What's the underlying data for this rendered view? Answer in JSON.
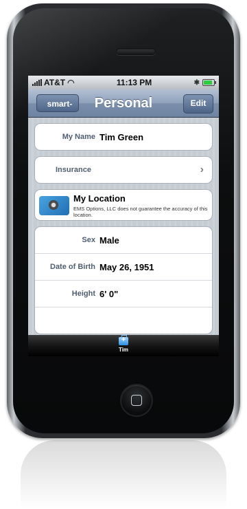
{
  "status_bar": {
    "carrier": "AT&T",
    "time": "11:13 PM"
  },
  "nav": {
    "back_label": "smart-ICE",
    "title": "Personal",
    "edit_label": "Edit"
  },
  "name_row": {
    "label": "My Name",
    "value": "Tim Green"
  },
  "insurance_row": {
    "label": "Insurance"
  },
  "location": {
    "title": "My Location",
    "note": "EMS Options, LLC does not guarantee the accuracy of this location."
  },
  "details": [
    {
      "label": "Sex",
      "value": "Male"
    },
    {
      "label": "Date of Birth",
      "value": "May 26, 1951"
    },
    {
      "label": "Height",
      "value": "6' 0\""
    }
  ],
  "tab_bar": {
    "tab_label": "Tim"
  },
  "colors": {
    "nav_blue": "#7b8fab",
    "back_button": "#4d6589"
  }
}
